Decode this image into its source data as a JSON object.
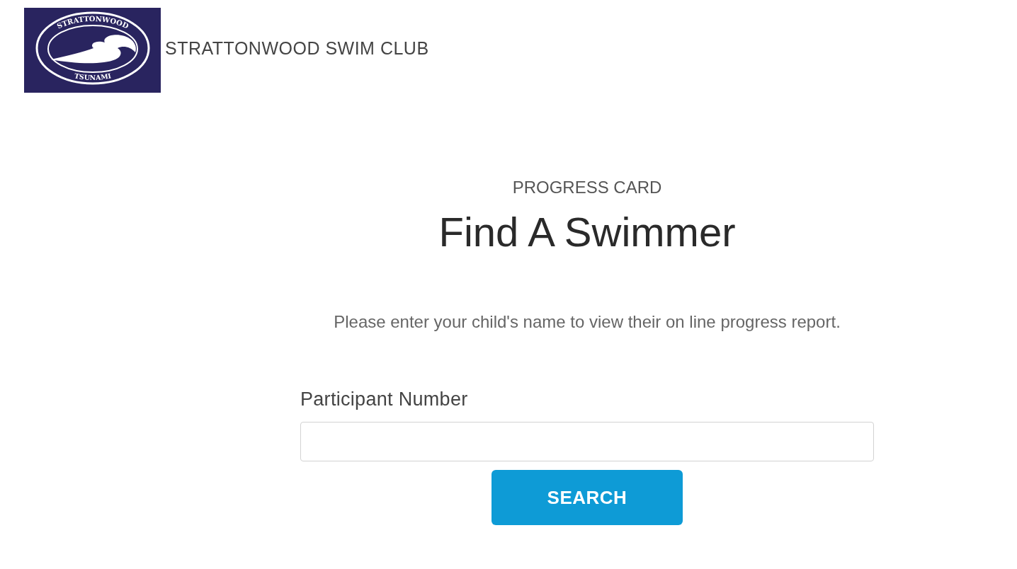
{
  "header": {
    "logo": {
      "top_text": "STRATTONWOOD",
      "bottom_text": "TSUNAMI"
    },
    "site_title": "STRATTONWOOD SWIM CLUB"
  },
  "main": {
    "eyebrow": "PROGRESS CARD",
    "title": "Find A Swimmer",
    "instructions": "Please enter your child's name to view their on line progress report.",
    "field": {
      "label": "Participant Number"
    },
    "button": "SEARCH"
  }
}
